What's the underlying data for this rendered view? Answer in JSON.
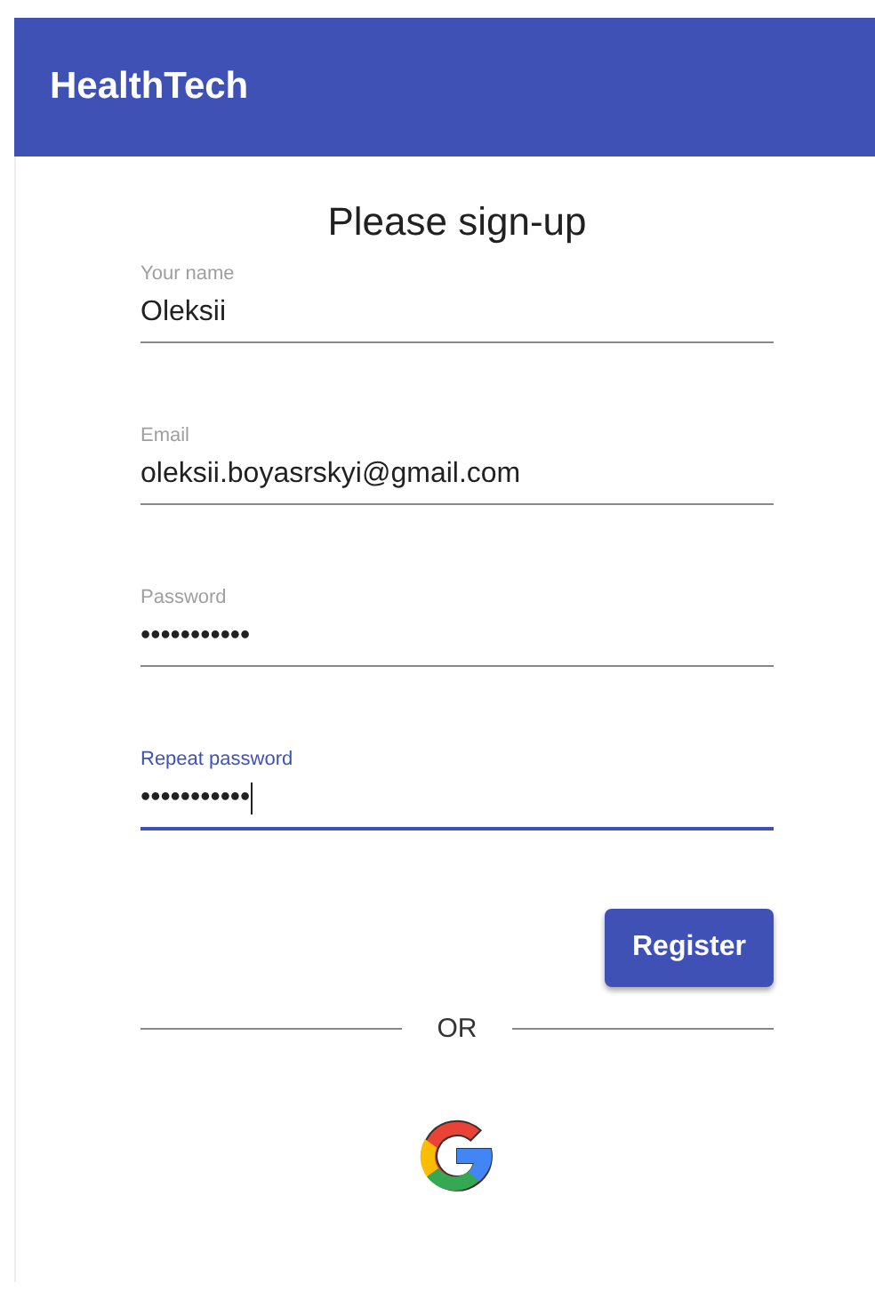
{
  "app_bar": {
    "title": "HealthTech"
  },
  "form": {
    "title": "Please sign-up",
    "fields": [
      {
        "label": "Your name",
        "value": "Oleksii",
        "focused": false
      },
      {
        "label": "Email",
        "value": "oleksii.boyasrskyi@gmail.com",
        "focused": false
      },
      {
        "label": "Password",
        "value": "•••••••••••",
        "focused": false
      },
      {
        "label": "Repeat password",
        "value": "•••••••••••",
        "focused": true
      }
    ],
    "register_button": "Register",
    "divider_text": "OR"
  }
}
